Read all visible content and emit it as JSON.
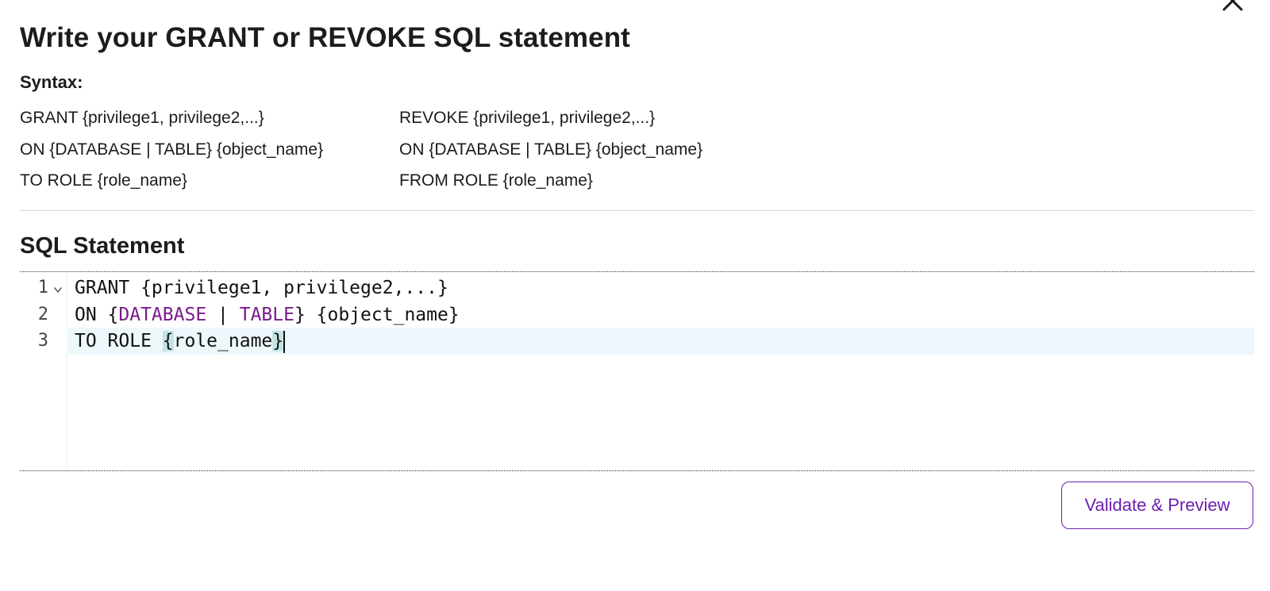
{
  "dialog": {
    "title": "Write your GRANT or REVOKE SQL statement",
    "close_icon": "close-icon"
  },
  "syntax": {
    "label": "Syntax:",
    "grant": [
      "GRANT {privilege1, privilege2,...}",
      "ON {DATABASE | TABLE} {object_name}",
      "TO ROLE {role_name}"
    ],
    "revoke": [
      "REVOKE {privilege1, privilege2,...}",
      "ON {DATABASE | TABLE} {object_name}",
      "FROM ROLE {role_name}"
    ]
  },
  "editor": {
    "section_title": "SQL Statement",
    "line_numbers": [
      "1",
      "2",
      "3"
    ],
    "fold_icon": "chevron-down-icon",
    "lines": {
      "l1": "GRANT {privilege1, privilege2,...}",
      "l2_pre": "ON {",
      "l2_kw1": "DATABASE",
      "l2_mid": " | ",
      "l2_kw2": "TABLE",
      "l2_post": "} {object_name}",
      "l3_pre": "TO ROLE ",
      "l3_open": "{",
      "l3_body": "role_name",
      "l3_close": "}"
    },
    "active_line": 3
  },
  "actions": {
    "validate_label": "Validate & Preview"
  },
  "colors": {
    "accent": "#6b1fb0",
    "keyword": "#7a1a8c",
    "active_line_bg": "#eef8fc",
    "bracket_match_bg": "#c3e4e2"
  }
}
